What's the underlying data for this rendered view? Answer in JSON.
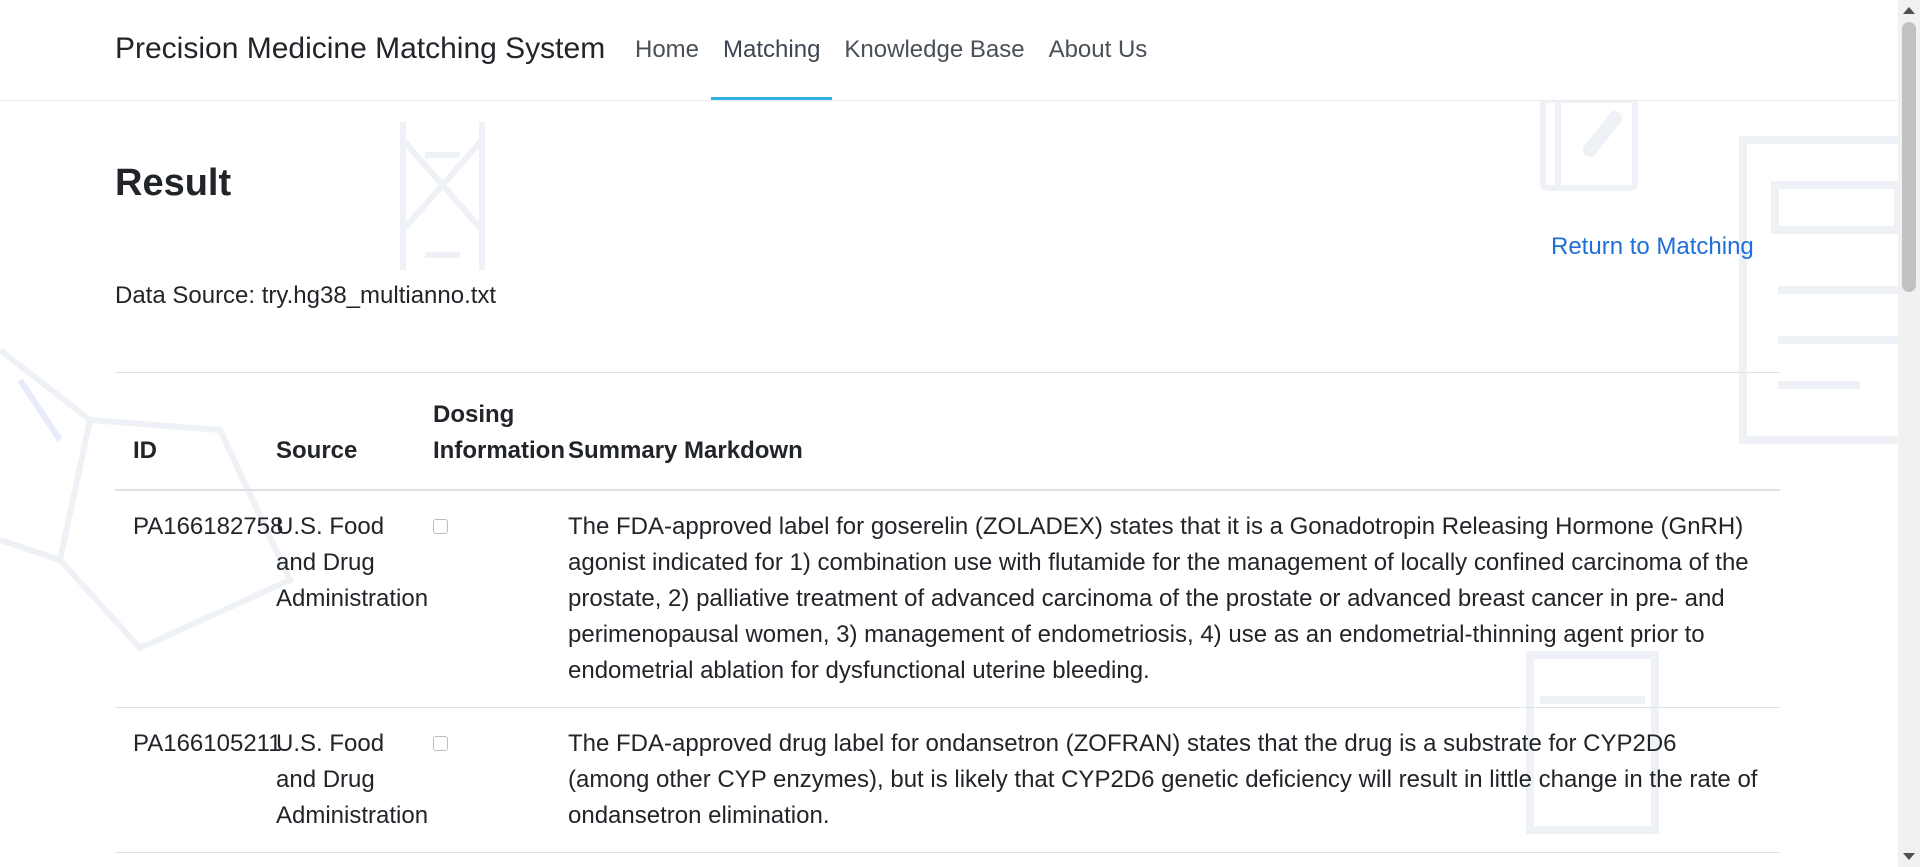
{
  "app": {
    "brand": "Precision Medicine Matching System",
    "nav": [
      {
        "label": "Home",
        "active": false
      },
      {
        "label": "Matching",
        "active": true
      },
      {
        "label": "Knowledge Base",
        "active": false
      },
      {
        "label": "About Us",
        "active": false
      }
    ],
    "accent_color": "#2bb3e6",
    "link_color": "#1e6fd9"
  },
  "page": {
    "title": "Result",
    "return_link": "Return to Matching",
    "data_source": "Data Source: try.hg38_multianno.txt"
  },
  "table": {
    "headers": {
      "id": "ID",
      "source": "Source",
      "dosing": "Dosing Information",
      "summary": "Summary Markdown"
    },
    "rows": [
      {
        "id": "PA166182758",
        "source": "U.S. Food and Drug Administration",
        "dosing_checked": false,
        "summary": "The FDA-approved label for goserelin (ZOLADEX) states that it is a Gonadotropin Releasing Hormone (GnRH) agonist indicated for 1) combination use with flutamide for the management of locally confined carcinoma of the prostate, 2) palliative treatment of advanced carcinoma of the prostate or advanced breast cancer in pre- and perimenopausal women, 3) management of endometriosis, 4) use as an endometrial-thinning agent prior to endometrial ablation for dysfunctional uterine bleeding."
      },
      {
        "id": "PA166105211",
        "source": "U.S. Food and Drug Administration",
        "dosing_checked": false,
        "summary": "The FDA-approved drug label for ondansetron (ZOFRAN) states that the drug is a substrate for CYP2D6 (among other CYP enzymes), but is likely that CYP2D6 genetic deficiency will result in little change in the rate of ondansetron elimination."
      }
    ]
  },
  "icons": {
    "background": [
      "dna-icon",
      "molecule-icon",
      "clipboard-icon",
      "document-icon"
    ],
    "checkbox": "checkbox-icon"
  }
}
